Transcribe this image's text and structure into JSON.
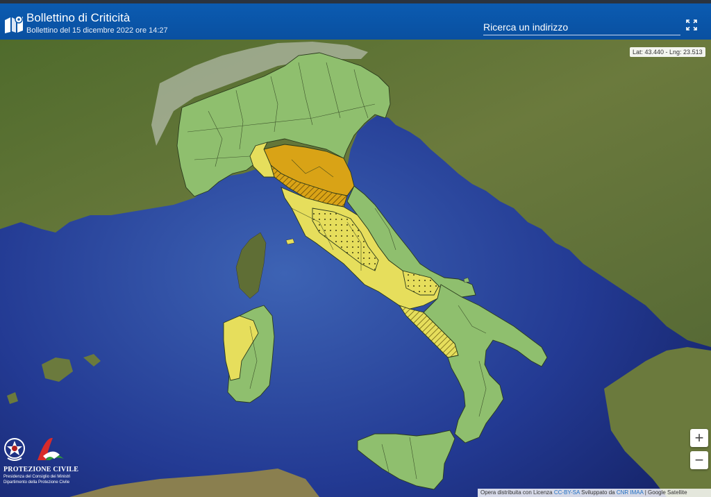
{
  "header": {
    "title": "Bollettino di Criticità",
    "subtitle": "Bollettino del 15 dicembre 2022 ore 14:27",
    "search_placeholder": "Ricerca un indirizzo"
  },
  "coords": {
    "text": "Lat: 43.440 - Lng: 23.513"
  },
  "zoom": {
    "in_label": "+",
    "out_label": "−"
  },
  "attribution": {
    "prefix": "Opera distribuita con Licenza ",
    "license": "CC-BY-SA",
    "middle": " Sviluppato da ",
    "developer": "CNR IMAA",
    "suffix": " | Google Satellite"
  },
  "branding": {
    "name": "PROTEZIONE CIVILE",
    "line1": "Presidenza del Consiglio dei Ministri",
    "line2": "Dipartimento della Protezione Civile"
  },
  "colors": {
    "green_zone": "#8fbf6e",
    "yellow_zone": "#e6de5c",
    "orange_zone": "#d9a316",
    "sea_deep": "#1f3288",
    "sea_shallow": "#3a63b8",
    "land": "#6d7a3e",
    "header": "#0a56a8"
  }
}
